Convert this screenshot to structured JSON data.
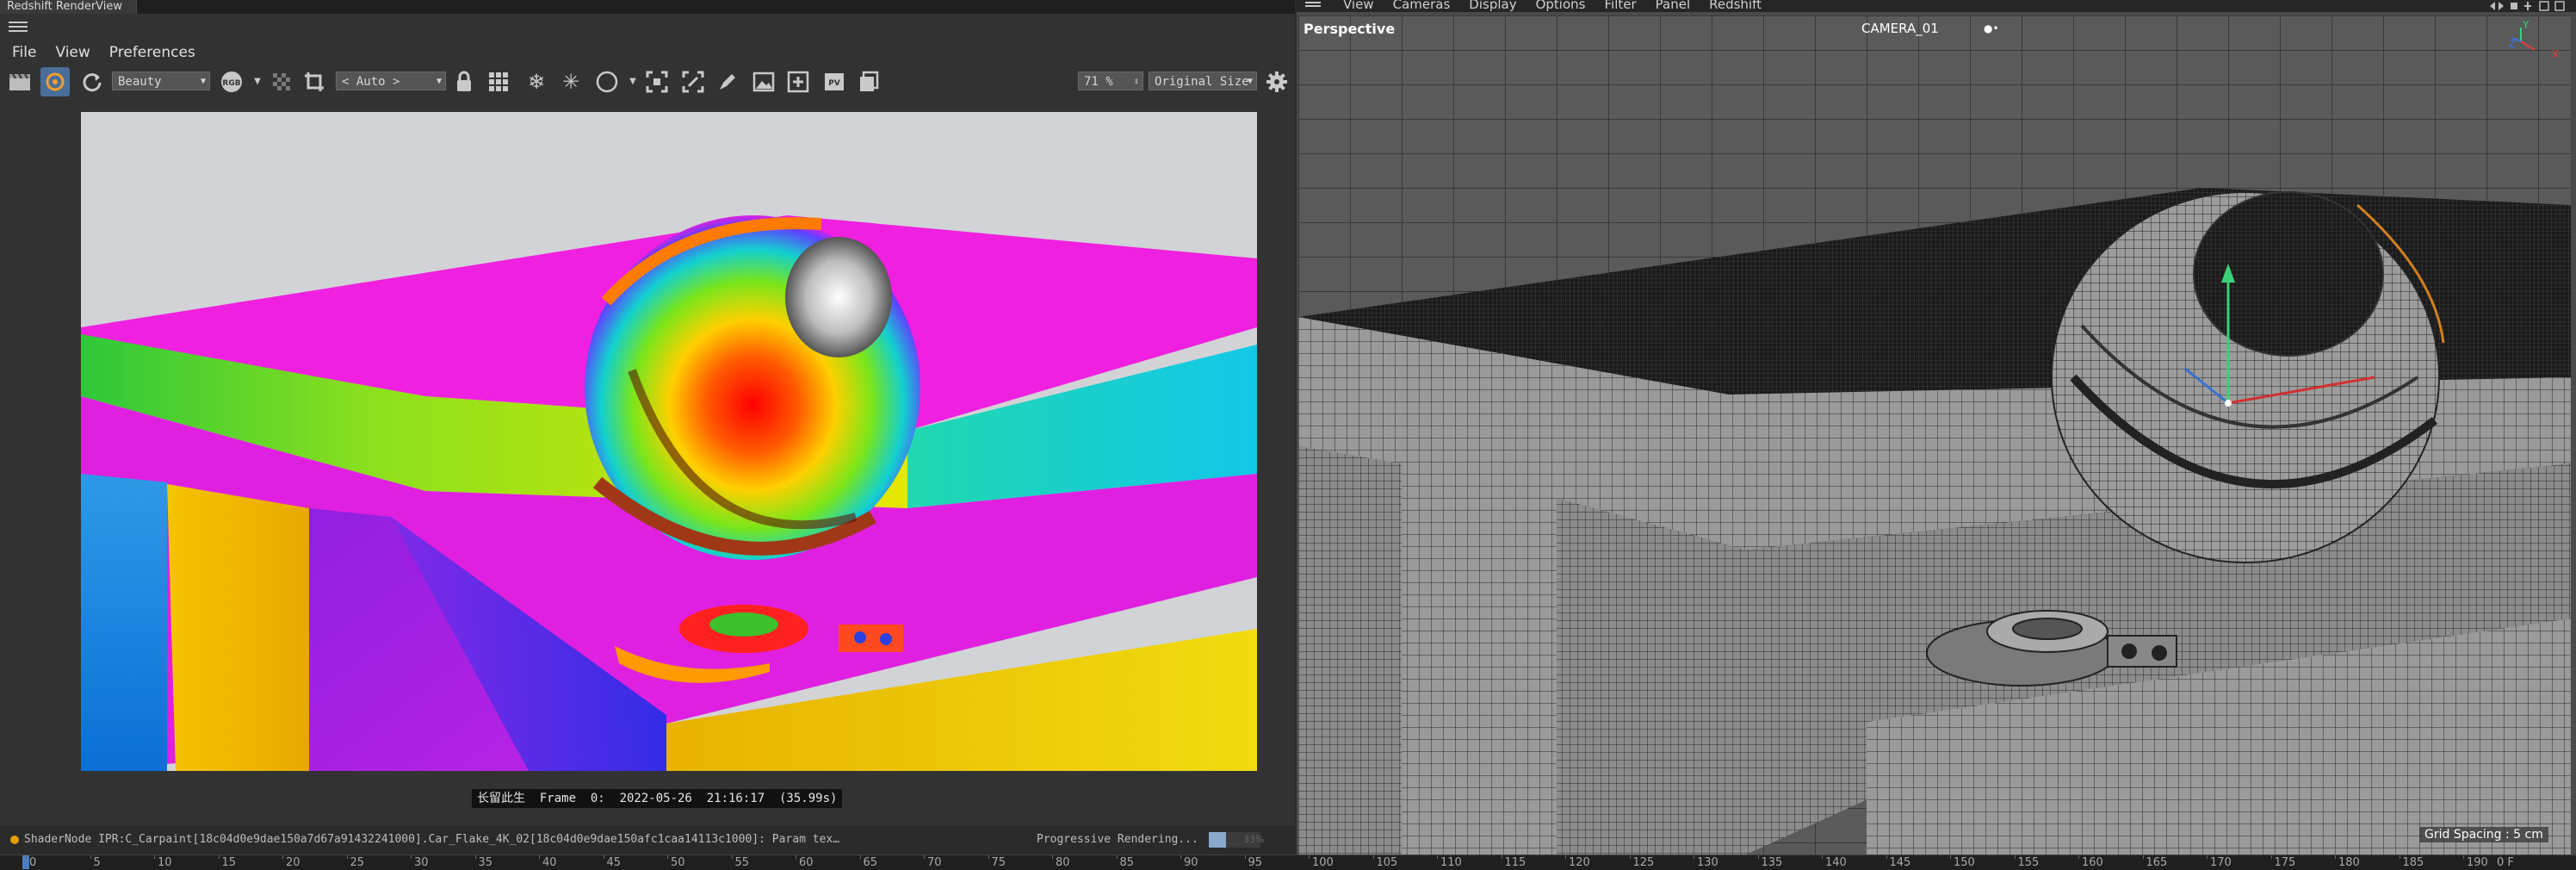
{
  "renderview": {
    "title": "Redshift RenderView",
    "menu": [
      "File",
      "View",
      "Preferences"
    ],
    "toolbar": {
      "aov_select": "Beauty",
      "rgb_label": "RGB",
      "camera_select": "< Auto >",
      "zoom_value": "71 %",
      "size_select": "Original Size"
    },
    "frame_info": "长留此生  Frame  0:  2022-05-26  21:16:17  (35.99s)",
    "status_text": "ShaderNode IPR:C_Carpaint[18c04d0e9dae150a7d67a91432241000].Car_Flake_4K_02[18c04d0e9dae150afc1caa14113c1000]: Param tex…",
    "progress_label": "Progressive Rendering...",
    "progress_value": 0.33,
    "progress_text": "33%"
  },
  "viewport": {
    "menu": [
      "View",
      "Cameras",
      "Display",
      "Options",
      "Filter",
      "Panel",
      "Redshift"
    ],
    "label": "Perspective",
    "camera": "CAMERA_01",
    "grid_spacing": "Grid Spacing : 5 cm",
    "axis_labels": {
      "y": "Y",
      "z": "Z",
      "x": "X"
    }
  },
  "timeline": {
    "current_frame": 0,
    "ticks": [
      "0",
      "5",
      "10",
      "15",
      "20",
      "25",
      "30",
      "35",
      "40",
      "45",
      "50",
      "55",
      "60",
      "65",
      "70",
      "75",
      "80",
      "85",
      "90",
      "95",
      "100",
      "105",
      "110",
      "115",
      "120",
      "125",
      "130",
      "135",
      "140",
      "145",
      "150",
      "155",
      "160",
      "165",
      "170",
      "175",
      "180",
      "185",
      "190"
    ],
    "end_label": "0 F"
  },
  "colors": {
    "accent": "#4a7fc4",
    "status_dot": "#e5a000",
    "progress_fill": "#8aa8cc"
  },
  "icons": [
    "clapper-icon",
    "ipr-icon",
    "refresh-icon",
    "lock-icon",
    "grid-icon",
    "snowflake-icon",
    "snowflake-alt-icon",
    "circle-icon",
    "fit-icon",
    "crop-icon",
    "edit-icon",
    "image-icon",
    "add-icon",
    "pv-icon",
    "copy-icon",
    "settings-icon"
  ]
}
